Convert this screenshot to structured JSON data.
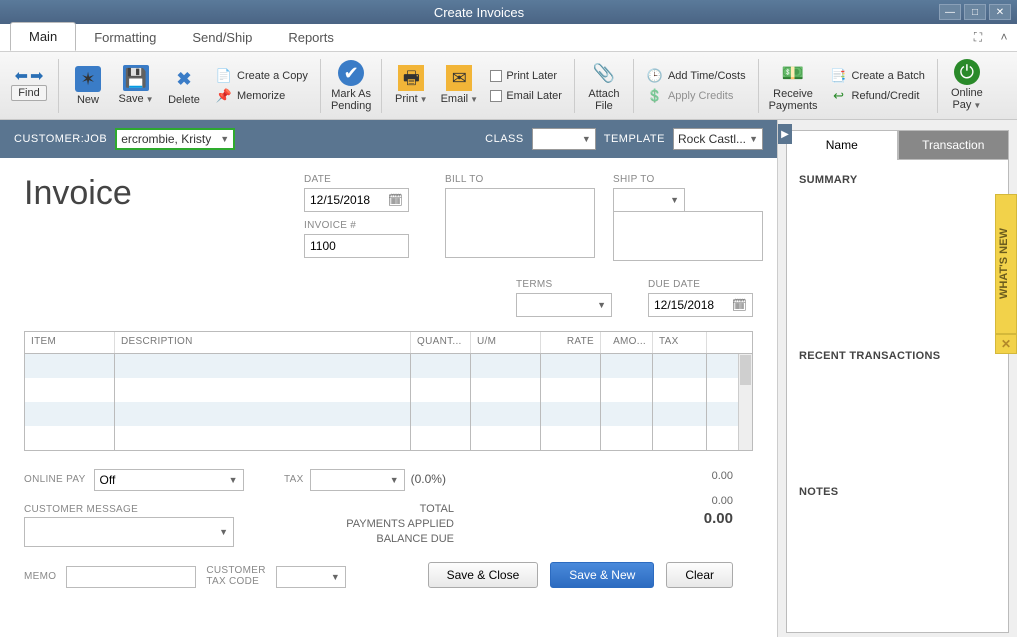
{
  "window": {
    "title": "Create Invoices"
  },
  "tabs": {
    "main": "Main",
    "formatting": "Formatting",
    "sendship": "Send/Ship",
    "reports": "Reports"
  },
  "toolbar": {
    "find": "Find",
    "new": "New",
    "save": "Save",
    "delete": "Delete",
    "create_copy": "Create a Copy",
    "memorize": "Memorize",
    "mark_pending": "Mark As\nPending",
    "print": "Print",
    "email": "Email",
    "print_later": "Print Later",
    "email_later": "Email Later",
    "attach": "Attach\nFile",
    "add_time": "Add Time/Costs",
    "apply_credits": "Apply Credits",
    "receive": "Receive\nPayments",
    "create_batch": "Create a Batch",
    "refund": "Refund/Credit",
    "online_pay": "Online\nPay"
  },
  "custbar": {
    "customer_lbl": "CUSTOMER:JOB",
    "customer_val": "ercrombie, Kristy",
    "class_lbl": "CLASS",
    "class_val": "",
    "template_lbl": "TEMPLATE",
    "template_val": "Rock Castl..."
  },
  "invoice": {
    "title": "Invoice",
    "date_lbl": "DATE",
    "date_val": "12/15/2018",
    "invnum_lbl": "INVOICE #",
    "invnum_val": "1100",
    "billto_lbl": "BILL TO",
    "billto_val": "",
    "shipto_lbl": "SHIP TO",
    "shipto_val": "",
    "terms_lbl": "TERMS",
    "terms_val": "",
    "due_lbl": "DUE DATE",
    "due_val": "12/15/2018"
  },
  "grid_headers": {
    "item": "ITEM",
    "desc": "DESCRIPTION",
    "qty": "QUANT...",
    "um": "U/M",
    "rate": "RATE",
    "amo": "AMO...",
    "tax": "TAX"
  },
  "bottom": {
    "online_pay_lbl": "ONLINE PAY",
    "online_pay_val": "Off",
    "cust_msg_lbl": "CUSTOMER MESSAGE",
    "cust_msg_val": "",
    "memo_lbl": "MEMO",
    "memo_val": "",
    "cust_tax_lbl": "CUSTOMER\nTAX CODE",
    "cust_tax_val": "",
    "tax_lbl": "TAX",
    "tax_dd": "",
    "tax_pct": "(0.0%)",
    "tax_amt": "0.00",
    "total_lbl": "TOTAL",
    "total_val": "",
    "pay_lbl": "PAYMENTS APPLIED",
    "pay_val": "0.00",
    "bal_lbl": "BALANCE DUE",
    "bal_val": "0.00"
  },
  "buttons": {
    "save_close": "Save & Close",
    "save_new": "Save & New",
    "clear": "Clear"
  },
  "right": {
    "name_tab": "Name",
    "trans_tab": "Transaction",
    "summary": "SUMMARY",
    "recent": "RECENT TRANSACTIONS",
    "notes": "NOTES"
  },
  "whatsnew": "WHAT'S NEW"
}
